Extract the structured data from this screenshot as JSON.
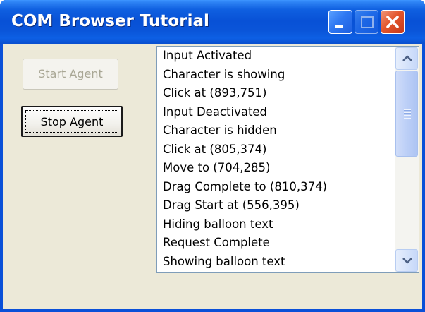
{
  "window": {
    "title": "COM Browser Tutorial"
  },
  "buttons": {
    "start_label": "Start Agent",
    "start_enabled": false,
    "stop_label": "Stop Agent",
    "stop_focused": true
  },
  "log": {
    "items": [
      "Input Activated",
      "Character is showing",
      "Click at (893,751)",
      "Input Deactivated",
      "Character is hidden",
      "Click at (805,374)",
      "Move to (704,285)",
      "Drag Complete to (810,374)",
      "Drag Start at (556,395)",
      "Hiding balloon text",
      "Request Complete",
      "Showing balloon text"
    ]
  },
  "icons": {
    "minimize": "minimize-icon",
    "maximize": "maximize-icon",
    "close": "close-icon",
    "scroll_up": "chevron-up-icon",
    "scroll_down": "chevron-down-icon",
    "grip": "scrollbar-grip-icon"
  },
  "colors": {
    "titlebar": "#0a50d8",
    "close_button": "#e3562c",
    "client_background": "#ece9d8"
  }
}
